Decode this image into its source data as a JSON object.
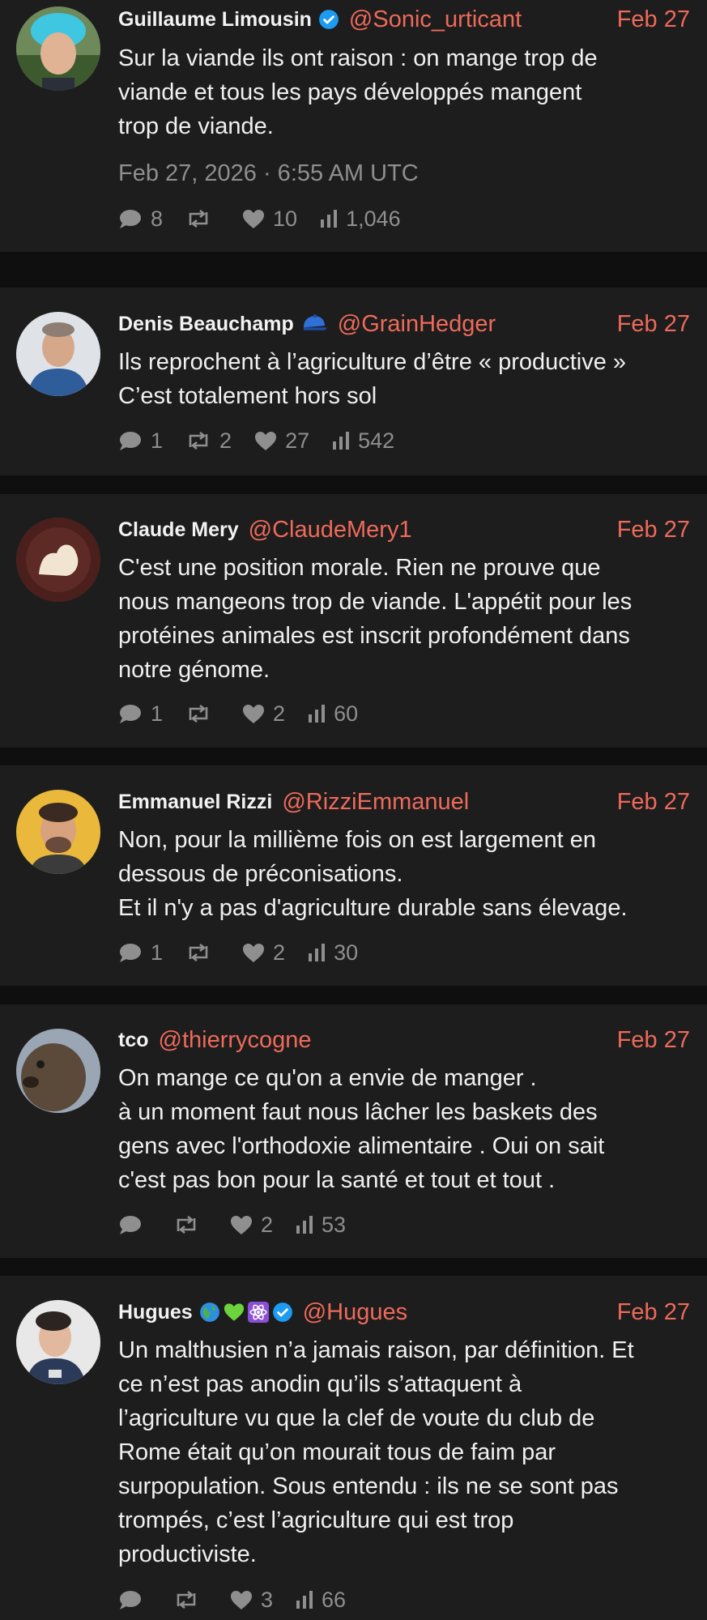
{
  "colors": {
    "background": "#0f0f0f",
    "card": "#1d1d1d",
    "accent": "#ee6a5a",
    "muted": "#8f8f8f",
    "verified": "#1d9bf0"
  },
  "tweets": [
    {
      "name": "Guillaume Limousin",
      "badges": [
        "verified-icon"
      ],
      "handle": "@Sonic_urticant",
      "date": "Feb 27",
      "lines": [
        "Sur la viande ils ont raison : on mange trop de",
        "viande et tous les pays développés mangent",
        "trop de viande."
      ],
      "timestamp": "Feb 27, 2026 · 6:55 AM UTC",
      "stats": {
        "replies": "8",
        "retweets": "",
        "likes": "10",
        "views": "1,046"
      }
    },
    {
      "name": "Denis Beauchamp",
      "badges": [
        "blue-cap-emoji-icon"
      ],
      "handle": "@GrainHedger",
      "date": "Feb 27",
      "lines": [
        "Ils reprochent à l’agriculture d’être « productive »",
        "C’est totalement hors sol"
      ],
      "stats": {
        "replies": "1",
        "retweets": "2",
        "likes": "27",
        "views": "542"
      }
    },
    {
      "name": "Claude Mery",
      "badges": [],
      "handle": "@ClaudeMery1",
      "date": "Feb 27",
      "lines": [
        "C'est une position morale. Rien ne prouve que",
        "nous mangeons trop de viande. L'appétit pour les",
        "protéines animales est inscrit profondément dans",
        "notre génome."
      ],
      "stats": {
        "replies": "1",
        "retweets": "",
        "likes": "2",
        "views": "60"
      }
    },
    {
      "name": "Emmanuel Rizzi",
      "badges": [],
      "handle": "@RizziEmmanuel",
      "date": "Feb 27",
      "lines": [
        "Non, pour la millième fois on est largement en",
        "dessous de préconisations.",
        "Et il n'y a pas d'agriculture durable sans élevage."
      ],
      "stats": {
        "replies": "1",
        "retweets": "",
        "likes": "2",
        "views": "30"
      }
    },
    {
      "name": "tco",
      "badges": [],
      "handle": "@thierrycogne",
      "date": "Feb 27",
      "lines": [
        "On mange ce qu'on a envie de manger .",
        "à un moment faut nous lâcher les baskets des",
        "gens avec l'orthodoxie alimentaire . Oui on sait",
        "c'est pas bon pour la santé et tout et tout ."
      ],
      "stats": {
        "replies": "",
        "retweets": "",
        "likes": "2",
        "views": "53"
      }
    },
    {
      "name": "Hugues",
      "badges": [
        "globe-emoji-icon",
        "green-heart-emoji-icon",
        "atom-emoji-icon",
        "verified-icon"
      ],
      "handle": "@Hugues",
      "date": "Feb 27",
      "lines": [
        "Un malthusien n’a jamais raison, par définition. Et",
        "ce n’est pas anodin qu’ils s’attaquent à",
        "l’agriculture vu que la clef de voute du club de",
        "Rome était qu’on mourait tous de faim par",
        "surpopulation. Sous entendu : ils ne se sont pas",
        "trompés, c’est l’agriculture qui est trop",
        "productiviste."
      ],
      "stats": {
        "replies": "",
        "retweets": "",
        "likes": "3",
        "views": "66"
      }
    }
  ]
}
